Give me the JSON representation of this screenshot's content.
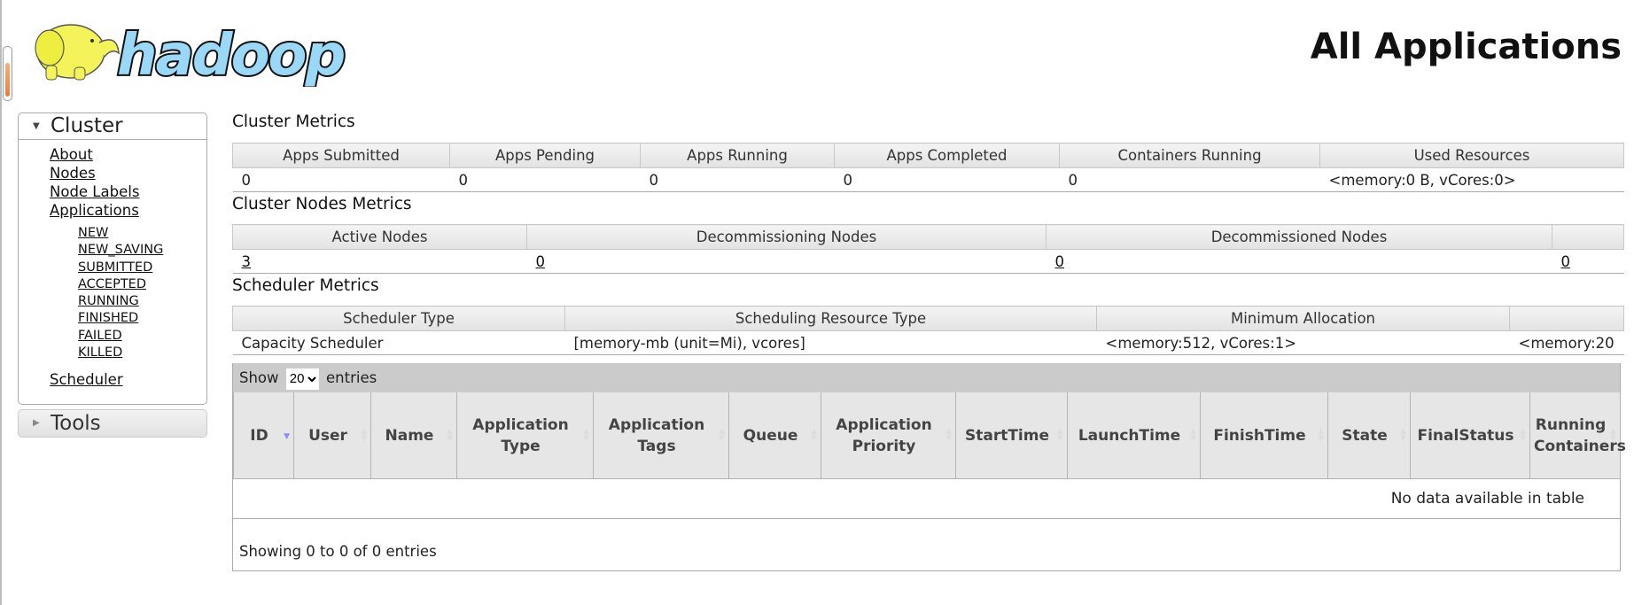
{
  "page_title": "All Applications",
  "logo_text": "hadoop",
  "sidebar": {
    "cluster_label": "Cluster",
    "links": [
      "About",
      "Nodes",
      "Node Labels",
      "Applications"
    ],
    "app_states": [
      "NEW",
      "NEW_SAVING",
      "SUBMITTED",
      "ACCEPTED",
      "RUNNING",
      "FINISHED",
      "FAILED",
      "KILLED"
    ],
    "scheduler_label": "Scheduler",
    "tools_label": "Tools"
  },
  "cluster_metrics": {
    "heading": "Cluster Metrics",
    "headers": [
      "Apps Submitted",
      "Apps Pending",
      "Apps Running",
      "Apps Completed",
      "Containers Running",
      "Used Resources"
    ],
    "values": [
      "0",
      "0",
      "0",
      "0",
      "0",
      "<memory:0 B, vCores:0>"
    ]
  },
  "nodes_metrics": {
    "heading": "Cluster Nodes Metrics",
    "headers": [
      "Active Nodes",
      "Decommissioning Nodes",
      "Decommissioned Nodes",
      ""
    ],
    "values": [
      "3",
      "0",
      "0",
      "0"
    ]
  },
  "scheduler_metrics": {
    "heading": "Scheduler Metrics",
    "headers": [
      "Scheduler Type",
      "Scheduling Resource Type",
      "Minimum Allocation",
      ""
    ],
    "values": [
      "Capacity Scheduler",
      "[memory-mb (unit=Mi), vcores]",
      "<memory:512, vCores:1>",
      "<memory:20"
    ]
  },
  "apps_table": {
    "show_label": "Show",
    "entries_label": "entries",
    "page_size": "20",
    "columns": [
      "ID",
      "User",
      "Name",
      "Application Type",
      "Application Tags",
      "Queue",
      "Application Priority",
      "StartTime",
      "LaunchTime",
      "FinishTime",
      "State",
      "FinalStatus",
      "Running Containers"
    ],
    "empty_message": "No data available in table",
    "info": "Showing 0 to 0 of 0 entries"
  }
}
